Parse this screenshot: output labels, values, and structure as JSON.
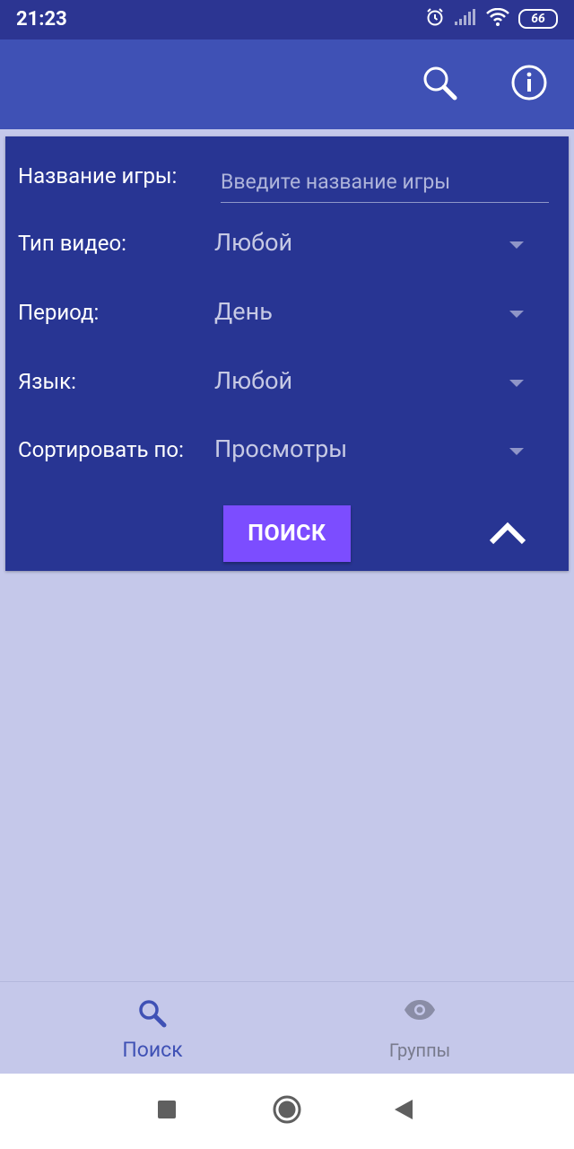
{
  "status_bar": {
    "time": "21:23",
    "icons": [
      "alarm-icon",
      "signal-icon",
      "wifi-icon",
      "battery-icon"
    ],
    "battery": "66"
  },
  "app_bar": {
    "actions": [
      "search-icon",
      "info-icon"
    ]
  },
  "search_form": {
    "game_name_label": "Название игры:",
    "game_name_placeholder": "Введите название игры",
    "game_name_value": "",
    "video_type_label": "Тип видео:",
    "video_type_value": "Любой",
    "period_label": "Период:",
    "period_value": "День",
    "language_label": "Язык:",
    "language_value": "Любой",
    "sort_label": "Сортировать по:",
    "sort_value": "Просмотры",
    "search_button": "Поиск",
    "collapse_icon": "chevron-up-icon"
  },
  "bottom_nav": {
    "items": [
      {
        "label": "Поиск",
        "icon": "search-icon",
        "active": true
      },
      {
        "label": "Группы",
        "icon": "eye-icon",
        "active": false
      }
    ]
  },
  "system_nav": [
    "recents-square-icon",
    "home-circle-icon",
    "back-triangle-icon"
  ],
  "colors": {
    "status_bar": "#2c3592",
    "app_bar": "#3f51b5",
    "panel": "#283593",
    "accent": "#7c4dff",
    "background": "#c5c8ea"
  }
}
